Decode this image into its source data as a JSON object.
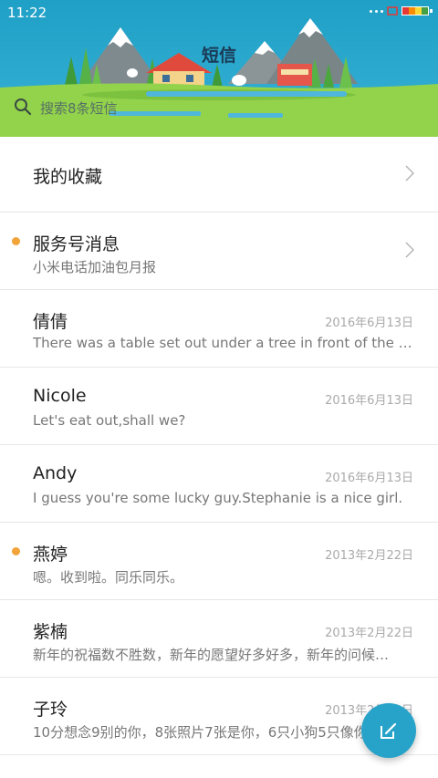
{
  "status": {
    "time": "11:22"
  },
  "header": {
    "title": "短信",
    "search_placeholder": "搜索8条短信"
  },
  "favorites": {
    "label": "我的收藏"
  },
  "conversations": [
    {
      "name": "服务号消息",
      "preview": "小米电话加油包月报",
      "date": "",
      "unread": true
    },
    {
      "name": "倩倩",
      "preview": "There was a table set out under a tree in front of the ho…",
      "date": "2016年6月13日",
      "unread": false
    },
    {
      "name": "Nicole",
      "preview": "Let's eat out,shall we?",
      "date": "2016年6月13日",
      "unread": false
    },
    {
      "name": "Andy",
      "preview": "I guess you're some lucky guy.Stephanie is a nice girl.",
      "date": "2016年6月13日",
      "unread": false
    },
    {
      "name": "燕婷",
      "preview": "嗯。收到啦。同乐同乐。",
      "date": "2013年2月22日",
      "unread": true
    },
    {
      "name": "紫楠",
      "preview": "新年的祝福数不胜数，新年的愿望好多好多，新年的问候…",
      "date": "2013年2月22日",
      "unread": false
    },
    {
      "name": "子玲",
      "preview": "10分想念9别的你，8张照片7张是你，6只小狗5只像你…",
      "date": "2013年2月22日",
      "unread": false
    }
  ],
  "colors": {
    "accent": "#27a3c9",
    "unread_dot": "#f2a33a",
    "header_bg": "#1fa0c6",
    "grass": "#8fd14a"
  },
  "icons": {
    "search": "search-icon",
    "chevron": "chevron-right-icon",
    "compose": "compose-icon"
  }
}
